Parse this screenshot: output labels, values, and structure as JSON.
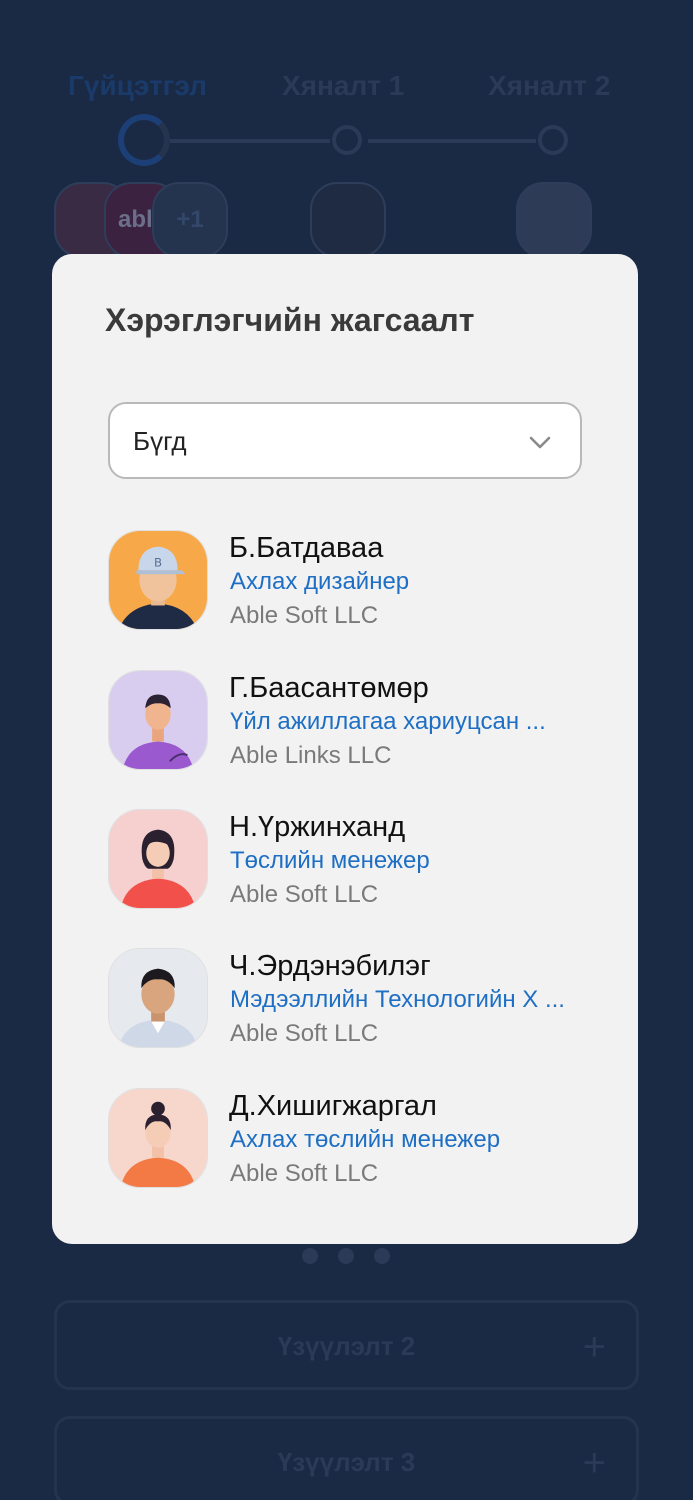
{
  "background": {
    "steps": [
      {
        "label": "Гүйцэтгэл"
      },
      {
        "label": "Хяналт 1"
      },
      {
        "label": "Хяналт 2"
      }
    ],
    "avatar_overflow": "+1",
    "avatar_brand": "able",
    "sections": [
      {
        "title": "Үзүүлэлт 2",
        "action": "+"
      },
      {
        "title": "Үзүүлэлт 3",
        "action": "+"
      }
    ]
  },
  "modal": {
    "title": "Хэрэглэгчийн жагсаалт",
    "filter": {
      "selected": "Бүгд",
      "icon": "chevron-down-icon"
    },
    "users": [
      {
        "name": "Б.Батдаваа",
        "role": "Ахлах дизайнер",
        "company": "Able Soft LLC",
        "avatar_bg": "#f7a94a"
      },
      {
        "name": "Г.Баасантөмөр",
        "role": "Үйл ажиллагаа хариуцсан  ...",
        "company": "Able Links LLC",
        "avatar_bg": "#d9cdef"
      },
      {
        "name": "Н.Үржинханд",
        "role": "Төслийн менежер",
        "company": "Able Soft LLC",
        "avatar_bg": "#f6cfcf"
      },
      {
        "name": "Ч.Эрдэнэбилэг",
        "role": "Мэдээллийн Технологийн Х ...",
        "company": "Able Soft LLC",
        "avatar_bg": "#e6e9ee"
      },
      {
        "name": "Д.Хишигжаргал",
        "role": "Ахлах төслийн менежер",
        "company": "Able Soft LLC",
        "avatar_bg": "#f7d6cc"
      }
    ]
  },
  "colors": {
    "backdrop": "#1b2a44",
    "modal_bg": "#f2f2f3",
    "role_text": "#1e6fc4",
    "company_text": "#7a7a7a"
  }
}
